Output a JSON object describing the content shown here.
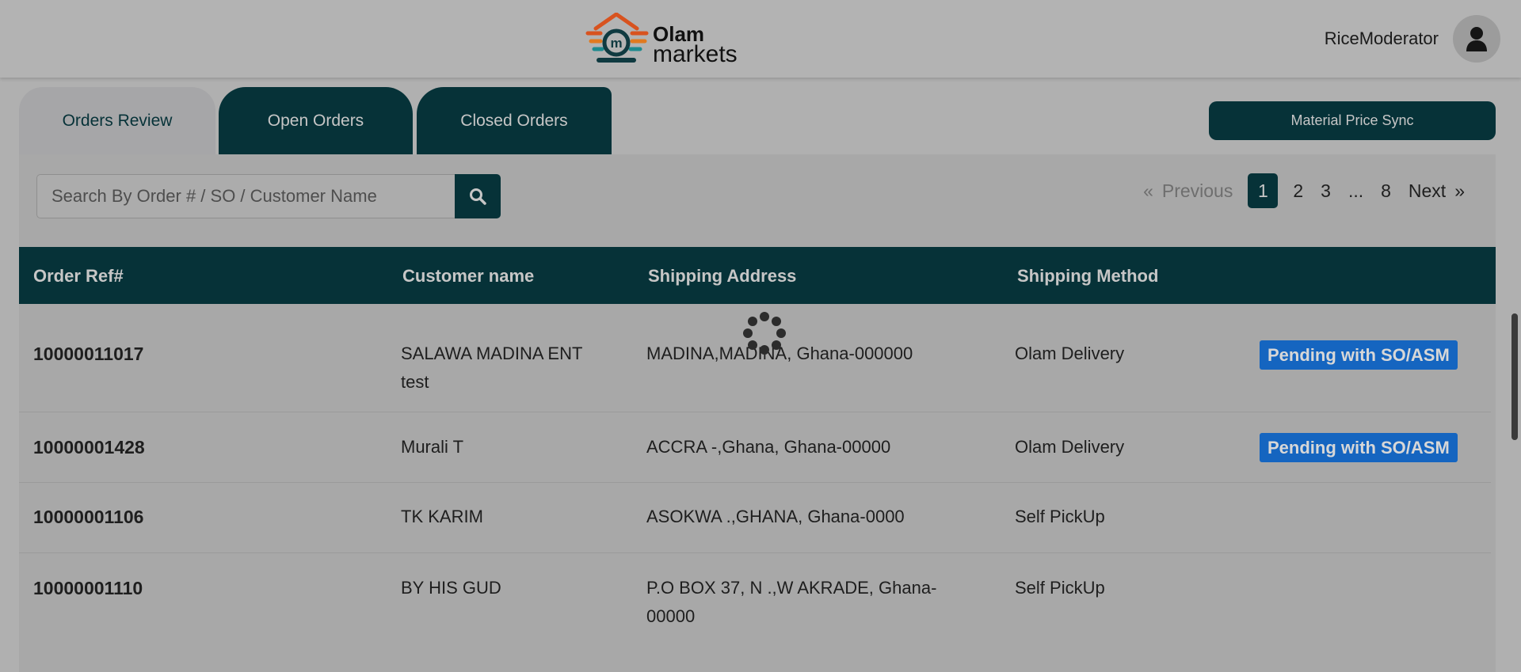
{
  "header": {
    "brand_line1": "Olam",
    "brand_line2": "markets",
    "username": "RiceModerator"
  },
  "tabs": [
    {
      "label": "Orders Review",
      "active": true
    },
    {
      "label": "Open Orders",
      "active": false
    },
    {
      "label": "Closed Orders",
      "active": false
    }
  ],
  "actions": {
    "material_price_sync": "Material Price Sync"
  },
  "search": {
    "placeholder": "Search By Order # / SO / Customer Name",
    "value": ""
  },
  "pagination": {
    "prev_arrow": "«",
    "prev_label": "Previous",
    "pages": [
      "1",
      "2",
      "3",
      "...",
      "8"
    ],
    "current": "1",
    "next_label": "Next",
    "next_arrow": "»"
  },
  "table": {
    "columns": [
      "Order Ref#",
      "Customer name",
      "Shipping Address",
      "Shipping Method"
    ],
    "rows": [
      {
        "ref": "10000011017",
        "customer": "SALAWA MADINA ENT test",
        "address": "MADINA,MADINA, Ghana-000000",
        "method": "Olam Delivery",
        "status": "Pending with SO/ASM"
      },
      {
        "ref": "10000001428",
        "customer": "Murali T",
        "address": "ACCRA -,Ghana, Ghana-00000",
        "method": "Olam Delivery",
        "status": "Pending with SO/ASM"
      },
      {
        "ref": "10000001106",
        "customer": "TK KARIM",
        "address": "ASOKWA .,GHANA, Ghana-0000",
        "method": "Self PickUp",
        "status": ""
      },
      {
        "ref": "10000001110",
        "customer": "BY HIS GUD",
        "address": "P.O BOX 37, N .,W AKRADE, Ghana-00000",
        "method": "Self PickUp",
        "status": ""
      }
    ]
  },
  "colors": {
    "primary": "#063238",
    "badge": "#1565c0",
    "logo_orange": "#d8531f",
    "logo_teal": "#1c8a8e"
  },
  "icons": {
    "search": "search-icon",
    "avatar": "user-icon",
    "loading": "loading-spinner-icon"
  }
}
